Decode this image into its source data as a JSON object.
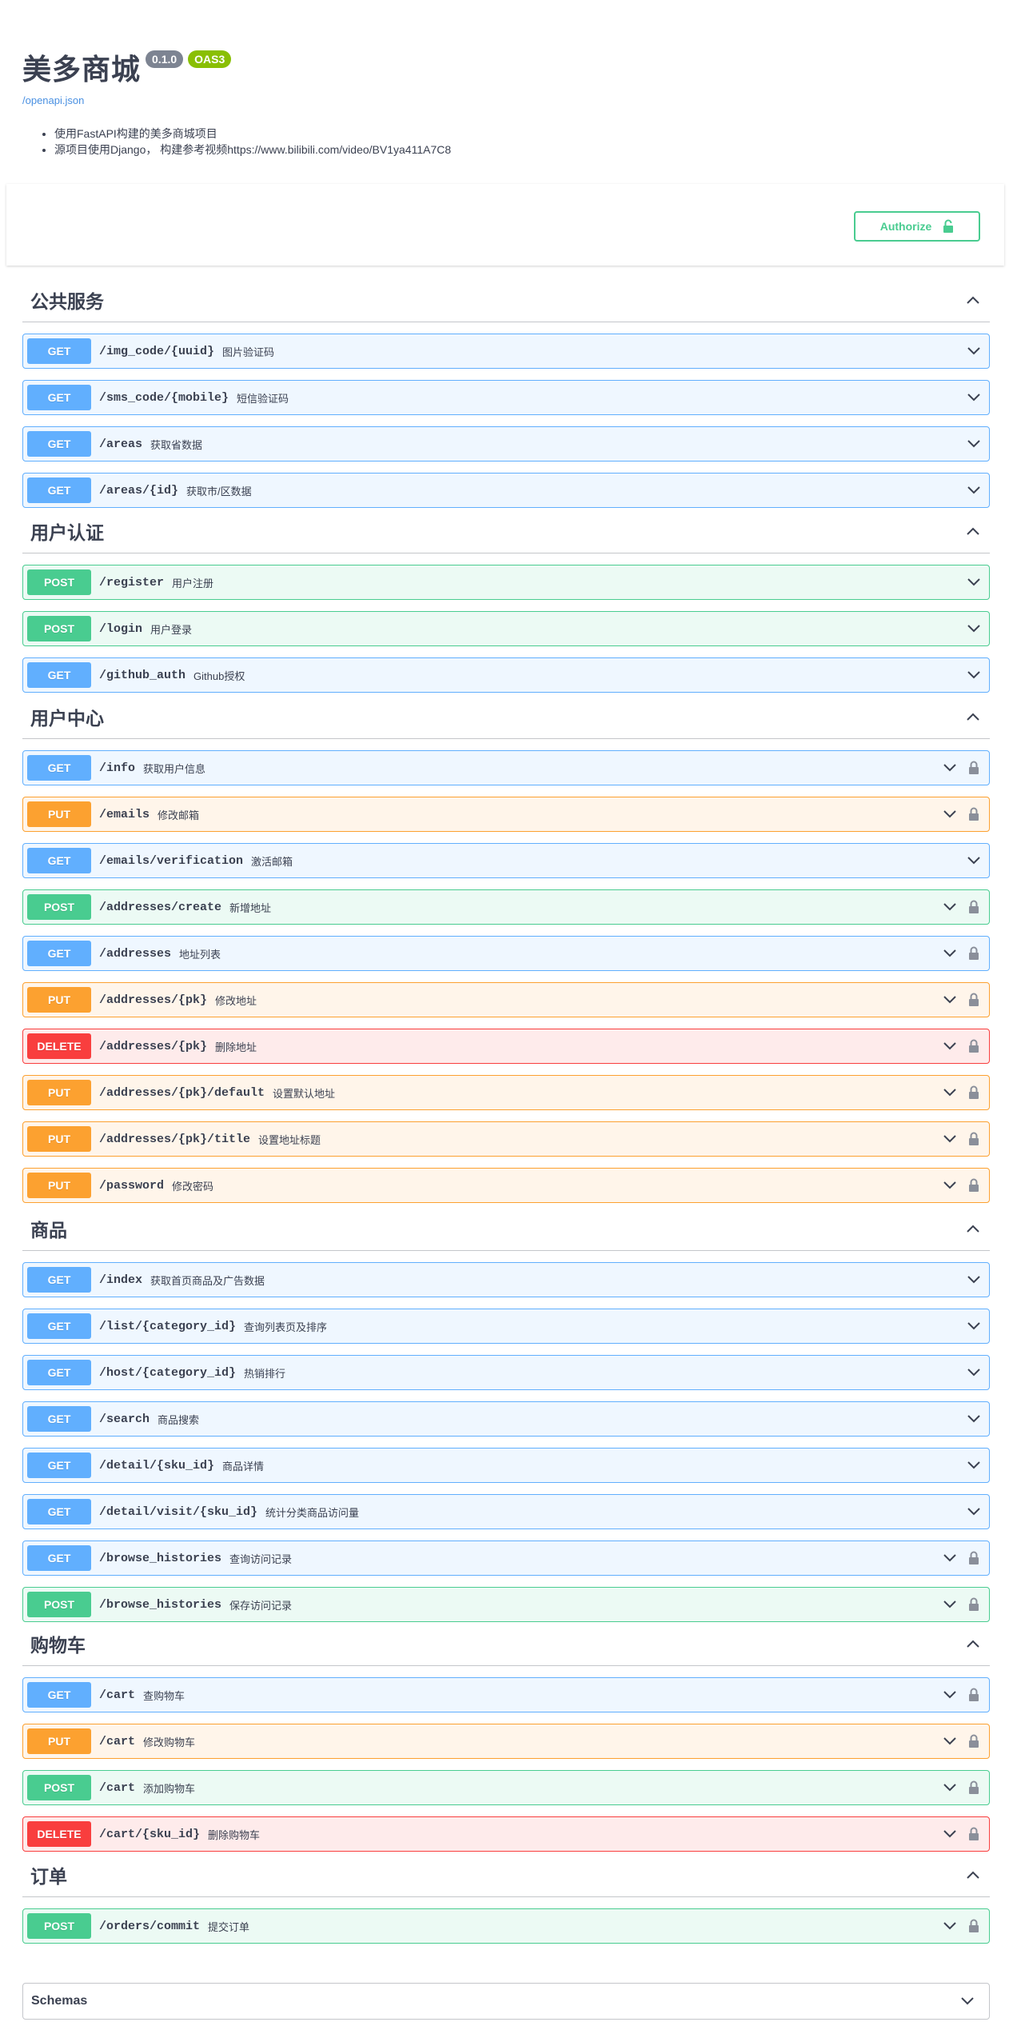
{
  "info": {
    "title": "美多商城",
    "version": "0.1.0",
    "oas": "OAS3",
    "spec_link": "/openapi.json",
    "description": [
      "使用FastAPI构建的美多商城项目",
      "源项目使用Django， 构建参考视频https://www.bilibili.com/video/BV1ya411A7C8"
    ]
  },
  "auth": {
    "label": "Authorize"
  },
  "colors": {
    "get": "#61affe",
    "post": "#49cc90",
    "put": "#fca130",
    "delete": "#f93e3e"
  },
  "sections": [
    {
      "name": "公共服务",
      "ops": [
        {
          "method": "GET",
          "path": "/img_code/{uuid}",
          "summary": "图片验证码",
          "locked": false
        },
        {
          "method": "GET",
          "path": "/sms_code/{mobile}",
          "summary": "短信验证码",
          "locked": false
        },
        {
          "method": "GET",
          "path": "/areas",
          "summary": "获取省数据",
          "locked": false
        },
        {
          "method": "GET",
          "path": "/areas/{id}",
          "summary": "获取市/区数据",
          "locked": false
        }
      ]
    },
    {
      "name": "用户认证",
      "ops": [
        {
          "method": "POST",
          "path": "/register",
          "summary": "用户注册",
          "locked": false
        },
        {
          "method": "POST",
          "path": "/login",
          "summary": "用户登录",
          "locked": false
        },
        {
          "method": "GET",
          "path": "/github_auth",
          "summary": "Github授权",
          "locked": false
        }
      ]
    },
    {
      "name": "用户中心",
      "ops": [
        {
          "method": "GET",
          "path": "/info",
          "summary": "获取用户信息",
          "locked": true
        },
        {
          "method": "PUT",
          "path": "/emails",
          "summary": "修改邮箱",
          "locked": true
        },
        {
          "method": "GET",
          "path": "/emails/verification",
          "summary": "激活邮箱",
          "locked": false
        },
        {
          "method": "POST",
          "path": "/addresses/create",
          "summary": "新增地址",
          "locked": true
        },
        {
          "method": "GET",
          "path": "/addresses",
          "summary": "地址列表",
          "locked": true
        },
        {
          "method": "PUT",
          "path": "/addresses/{pk}",
          "summary": "修改地址",
          "locked": true
        },
        {
          "method": "DELETE",
          "path": "/addresses/{pk}",
          "summary": "删除地址",
          "locked": true
        },
        {
          "method": "PUT",
          "path": "/addresses/{pk}/default",
          "summary": "设置默认地址",
          "locked": true
        },
        {
          "method": "PUT",
          "path": "/addresses/{pk}/title",
          "summary": "设置地址标题",
          "locked": true
        },
        {
          "method": "PUT",
          "path": "/password",
          "summary": "修改密码",
          "locked": true
        }
      ]
    },
    {
      "name": "商品",
      "ops": [
        {
          "method": "GET",
          "path": "/index",
          "summary": "获取首页商品及广告数据",
          "locked": false
        },
        {
          "method": "GET",
          "path": "/list/{category_id}",
          "summary": "查询列表页及排序",
          "locked": false
        },
        {
          "method": "GET",
          "path": "/host/{category_id}",
          "summary": "热销排行",
          "locked": false
        },
        {
          "method": "GET",
          "path": "/search",
          "summary": "商品搜索",
          "locked": false
        },
        {
          "method": "GET",
          "path": "/detail/{sku_id}",
          "summary": "商品详情",
          "locked": false
        },
        {
          "method": "GET",
          "path": "/detail/visit/{sku_id}",
          "summary": "统计分类商品访问量",
          "locked": false
        },
        {
          "method": "GET",
          "path": "/browse_histories",
          "summary": "查询访问记录",
          "locked": true
        },
        {
          "method": "POST",
          "path": "/browse_histories",
          "summary": "保存访问记录",
          "locked": true
        }
      ]
    },
    {
      "name": "购物车",
      "ops": [
        {
          "method": "GET",
          "path": "/cart",
          "summary": "查购物车",
          "locked": true
        },
        {
          "method": "PUT",
          "path": "/cart",
          "summary": "修改购物车",
          "locked": true
        },
        {
          "method": "POST",
          "path": "/cart",
          "summary": "添加购物车",
          "locked": true
        },
        {
          "method": "DELETE",
          "path": "/cart/{sku_id}",
          "summary": "删除购物车",
          "locked": true
        }
      ]
    },
    {
      "name": "订单",
      "ops": [
        {
          "method": "POST",
          "path": "/orders/commit",
          "summary": "提交订单",
          "locked": true
        }
      ]
    }
  ],
  "schemas": {
    "label": "Schemas"
  }
}
